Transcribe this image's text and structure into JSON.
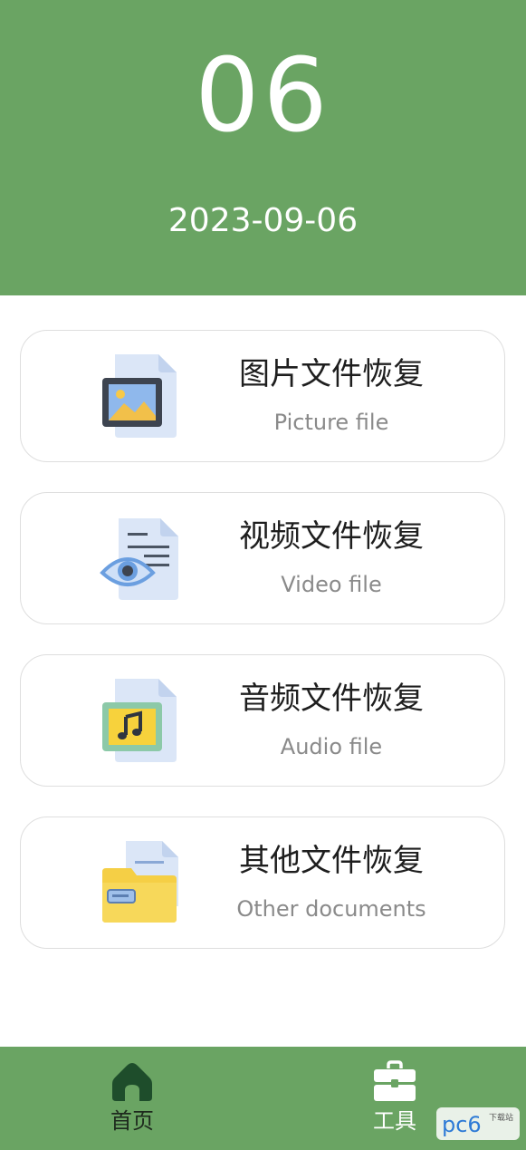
{
  "header": {
    "day": "06",
    "date": "2023-09-06"
  },
  "cards": [
    {
      "title": "图片文件恢复",
      "subtitle": "Picture file",
      "icon": "picture-file-icon"
    },
    {
      "title": "视频文件恢复",
      "subtitle": "Video file",
      "icon": "video-file-icon"
    },
    {
      "title": "音频文件恢复",
      "subtitle": "Audio file",
      "icon": "audio-file-icon"
    },
    {
      "title": "其他文件恢复",
      "subtitle": "Other documents",
      "icon": "folder-file-icon"
    }
  ],
  "tabbar": {
    "tabs": [
      {
        "label": "首页",
        "icon": "home-icon",
        "active": true
      },
      {
        "label": "工具",
        "icon": "toolbox-icon",
        "active": false
      }
    ]
  },
  "watermark": {
    "text": "pc6",
    "subtext": "下载站"
  },
  "colors": {
    "primary": "#6aa463",
    "active_tab": "#1e4d2b",
    "card_border": "#dedede"
  }
}
